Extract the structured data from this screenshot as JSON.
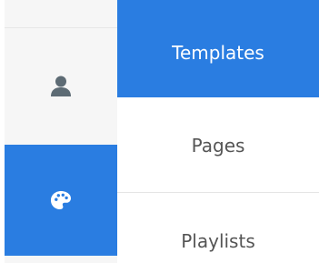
{
  "icon_rail": {
    "items": [
      {
        "icon": "user-icon",
        "active": false
      },
      {
        "icon": "palette-icon",
        "active": true
      }
    ]
  },
  "menu": {
    "items": [
      {
        "label": "Templates",
        "active": true
      },
      {
        "label": "Pages",
        "active": false
      },
      {
        "label": "Playlists",
        "active": false
      }
    ]
  },
  "colors": {
    "accent": "#2a7de1",
    "rail_background": "#f6f6f6",
    "text": "#555555",
    "active_text": "#ffffff",
    "divider": "#e5e5e5"
  }
}
